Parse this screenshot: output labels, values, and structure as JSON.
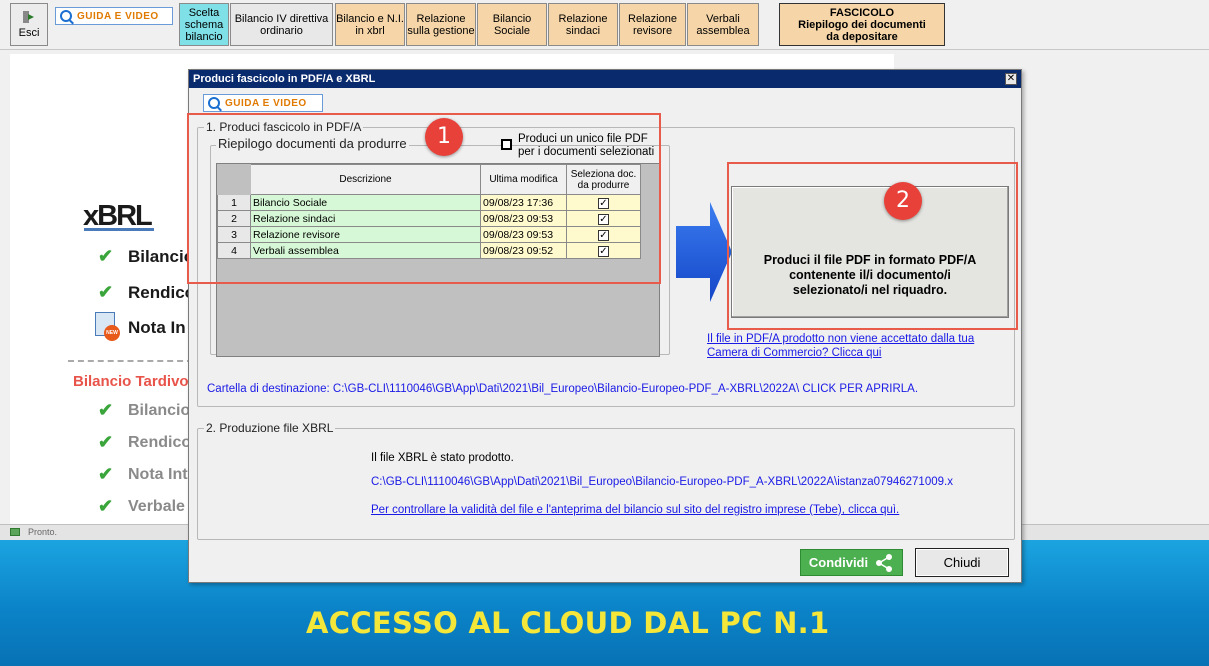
{
  "toolbar": {
    "exit_label": "Esci",
    "guide_label": "GUIDA E VIDEO",
    "tabs": [
      {
        "label": "Scelta schema bilancio",
        "color": "#7fe0e8"
      },
      {
        "label": "Bilancio IV direttiva ordinario",
        "color": "#e8e8e8"
      },
      {
        "label": "Bilancio e N.I. in xbrl",
        "color": "#f6d6a8"
      },
      {
        "label": "Relazione sulla gestione",
        "color": "#f6d6a8"
      },
      {
        "label": "Bilancio Sociale",
        "color": "#f6d6a8"
      },
      {
        "label": "Relazione sindaci",
        "color": "#f6d6a8"
      },
      {
        "label": "Relazione revisore",
        "color": "#f6d6a8"
      },
      {
        "label": "Verbali assemblea",
        "color": "#f6d6a8"
      }
    ],
    "fascicolo_label_1": "FASCICOLO",
    "fascicolo_label_2": "Riepilogo dei documenti",
    "fascicolo_label_3": "da depositare"
  },
  "background": {
    "xbrl_logo": "xBRL",
    "rows_top": [
      "Bilancio",
      "Rendico",
      "Nota In"
    ],
    "tardivo_label": "Bilancio Tardivo",
    "rows_bottom": [
      "Bilancio",
      "Rendico",
      "Nota Int",
      "Verbale"
    ]
  },
  "status": {
    "text": "Pronto."
  },
  "dialog": {
    "title": "Produci fascicolo in PDF/A e XBRL",
    "close_glyph": "✕",
    "guide_label": "GUIDA E VIDEO",
    "section1_title": "1. Produci fascicolo in PDF/A",
    "summary_title": "Riepilogo documenti da produrre",
    "single_pdf_label_1": "Produci un unico file PDF",
    "single_pdf_label_2": "per i documenti selezionati",
    "single_pdf_checked": false,
    "table": {
      "headers": [
        "Descrizione",
        "Ultima modifica",
        "Seleziona doc. da produrre"
      ],
      "header_sel_1": "Seleziona doc.",
      "header_sel_2": "da produrre",
      "rows": [
        {
          "n": "1",
          "desc": "Bilancio Sociale",
          "date": "09/08/23 17:36",
          "checked": "✓"
        },
        {
          "n": "2",
          "desc": "Relazione sindaci",
          "date": "09/08/23 09:53",
          "checked": "✓"
        },
        {
          "n": "3",
          "desc": "Relazione revisore",
          "date": "09/08/23 09:53",
          "checked": "✓"
        },
        {
          "n": "4",
          "desc": "Verbali assemblea",
          "date": "09/08/23 09:52",
          "checked": "✓"
        }
      ]
    },
    "produce_button_1": "Produci il file PDF in formato PDF/A",
    "produce_button_2": "contenente il/i documento/i",
    "produce_button_3": "selezionato/i nel riquadro.",
    "pdfa_link_1": "Il file in PDF/A prodotto non viene accettato dalla tua",
    "pdfa_link_2": "Camera di Commercio? Clicca qui",
    "destination": "Cartella di destinazione: C:\\GB-CLI\\1110046\\GB\\App\\Dati\\2021\\Bil_Europeo\\Bilancio-Europeo-PDF_A-XBRL\\2022A\\ CLICK PER APRIRLA.",
    "section2_title": "2. Produzione file XBRL",
    "xbrl_done": "Il file XBRL è stato prodotto.",
    "xbrl_path": "C:\\GB-CLI\\1110046\\GB\\App\\Dati\\2021\\Bil_Europeo\\Bilancio-Europeo-PDF_A-XBRL\\2022A\\istanza07946271009.x",
    "xbrl_check_link": "Per controllare la validità del file e l'anteprima del bilancio sul sito del registro imprese (Tebe), clicca quì.",
    "share_label": "Condividi",
    "close_label": "Chiudi",
    "badge_1": "1",
    "badge_2": "2"
  },
  "banner": {
    "text": "ACCESSO AL CLOUD DAL PC N.1"
  },
  "colors": {
    "accent_red": "#e8413a",
    "link_blue": "#1a1ae6",
    "share_green": "#4caf50",
    "banner_yellow": "#f5e63a"
  }
}
